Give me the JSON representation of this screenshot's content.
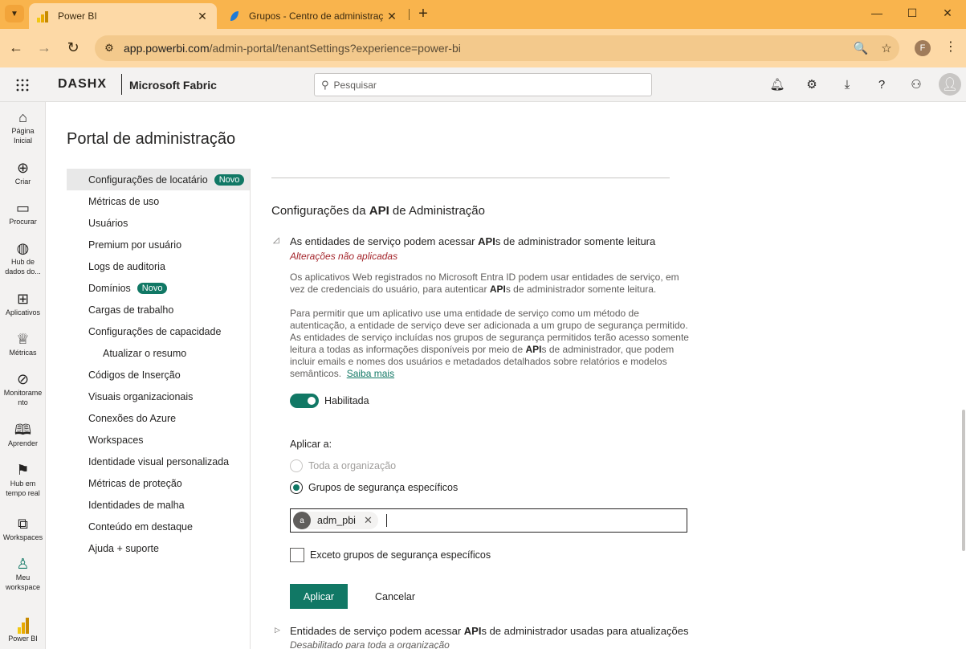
{
  "browser": {
    "tabs": [
      {
        "title": "Power BI",
        "active": true
      },
      {
        "title": "Grupos - Centro de administraç",
        "active": false
      }
    ],
    "url_host": "app.powerbi.com",
    "url_path": "/admin-portal/tenantSettings?experience=power-bi",
    "profile_initial": "F"
  },
  "header": {
    "brand": "DASHX",
    "product": "Microsoft Fabric",
    "search_placeholder": "Pesquisar"
  },
  "leftnav": [
    {
      "label1": "Página",
      "label2": "Inicial",
      "icon": "home-icon",
      "glyph": "⌂"
    },
    {
      "label1": "Criar",
      "label2": "",
      "icon": "plus-circle-icon",
      "glyph": "⊕"
    },
    {
      "label1": "Procurar",
      "label2": "",
      "icon": "folder-icon",
      "glyph": "🗀"
    },
    {
      "label1": "Hub de",
      "label2": "dados do...",
      "icon": "data-hub-icon",
      "glyph": "◍"
    },
    {
      "label1": "Aplicativos",
      "label2": "",
      "icon": "apps-icon",
      "glyph": "⊞"
    },
    {
      "label1": "Métricas",
      "label2": "",
      "icon": "trophy-icon",
      "glyph": "🏆"
    },
    {
      "label1": "Monitorame",
      "label2": "nto",
      "icon": "monitoring-icon",
      "glyph": "⊘"
    },
    {
      "label1": "Aprender",
      "label2": "",
      "icon": "book-icon",
      "glyph": "🕮"
    },
    {
      "label1": "Hub em",
      "label2": "tempo real",
      "icon": "realtime-hub-icon",
      "glyph": "⚑"
    },
    {
      "label1": "Workspaces",
      "label2": "",
      "icon": "workspaces-icon",
      "glyph": "⧉"
    },
    {
      "label1": "Meu",
      "label2": "workspace",
      "icon": "my-workspace-icon",
      "glyph": "♙"
    },
    {
      "label1": "Power BI",
      "label2": "",
      "icon": "powerbi-logo-icon",
      "glyph": ""
    }
  ],
  "page_title": "Portal de administração",
  "admin_nav": [
    {
      "label": "Configurações de locatário",
      "badge": "Novo",
      "selected": true,
      "sub": false
    },
    {
      "label": "Métricas de uso",
      "badge": "",
      "selected": false,
      "sub": false
    },
    {
      "label": "Usuários",
      "badge": "",
      "selected": false,
      "sub": false
    },
    {
      "label": "Premium por usuário",
      "badge": "",
      "selected": false,
      "sub": false
    },
    {
      "label": "Logs de auditoria",
      "badge": "",
      "selected": false,
      "sub": false
    },
    {
      "label": "Domínios",
      "badge": "Novo",
      "selected": false,
      "sub": false
    },
    {
      "label": "Cargas de trabalho",
      "badge": "",
      "selected": false,
      "sub": false
    },
    {
      "label": "Configurações de capacidade",
      "badge": "",
      "selected": false,
      "sub": false
    },
    {
      "label": "Atualizar o resumo",
      "badge": "",
      "selected": false,
      "sub": true
    },
    {
      "label": "Códigos de Inserção",
      "badge": "",
      "selected": false,
      "sub": false
    },
    {
      "label": "Visuais organizacionais",
      "badge": "",
      "selected": false,
      "sub": false
    },
    {
      "label": "Conexões do Azure",
      "badge": "",
      "selected": false,
      "sub": false
    },
    {
      "label": "Workspaces",
      "badge": "",
      "selected": false,
      "sub": false
    },
    {
      "label": "Identidade visual personalizada",
      "badge": "",
      "selected": false,
      "sub": false
    },
    {
      "label": "Métricas de proteção",
      "badge": "",
      "selected": false,
      "sub": false
    },
    {
      "label": "Identidades de malha",
      "badge": "",
      "selected": false,
      "sub": false
    },
    {
      "label": "Conteúdo em destaque",
      "badge": "",
      "selected": false,
      "sub": false
    },
    {
      "label": "Ajuda + suporte",
      "badge": "",
      "selected": false,
      "sub": false
    }
  ],
  "section": {
    "title_pre": "Configurações da ",
    "title_bold": "API",
    "title_post": " de Administração"
  },
  "setting1": {
    "title_pre": "As entidades de serviço podem acessar ",
    "title_bold": "API",
    "title_post": "s de administrador somente leitura",
    "status": "Alterações não aplicadas",
    "desc1_pre": "Os aplicativos Web registrados no Microsoft Entra ID podem usar entidades de serviço, em vez de credenciais do usuário, para autenticar ",
    "desc1_bold": "API",
    "desc1_post": "s de administrador somente leitura.",
    "desc2_pre": "Para permitir que um aplicativo use uma entidade de serviço como um método de autenticação, a entidade de serviço deve ser adicionada a um grupo de segurança permitido. As entidades de serviço incluídas nos grupos de segurança permitidos terão acesso somente leitura a todas as informações disponíveis por meio de ",
    "desc2_bold": "API",
    "desc2_post": "s de administrador, que podem incluir emails e nomes dos usuários e metadados detalhados sobre relatórios e modelos semânticos.",
    "learn_more": "Saiba mais",
    "toggle_label": "Habilitada",
    "toggle_on": true,
    "apply_to_label": "Aplicar a:",
    "option_all": "Toda a organização",
    "option_specific": "Grupos de segurança específicos",
    "chip_initial": "a",
    "chip_label": "adm_pbi",
    "except_label": "Exceto grupos de segurança específicos",
    "apply_button": "Aplicar",
    "cancel_button": "Cancelar"
  },
  "setting2": {
    "title_pre": "Entidades de serviço podem acessar ",
    "title_bold": "API",
    "title_post": "s de administrador usadas para atualizações",
    "status": "Desabilitado para toda a organização"
  },
  "colors": {
    "accent": "#117865",
    "browser_tab": "#f9b44d",
    "warning_text": "#a4262c"
  }
}
